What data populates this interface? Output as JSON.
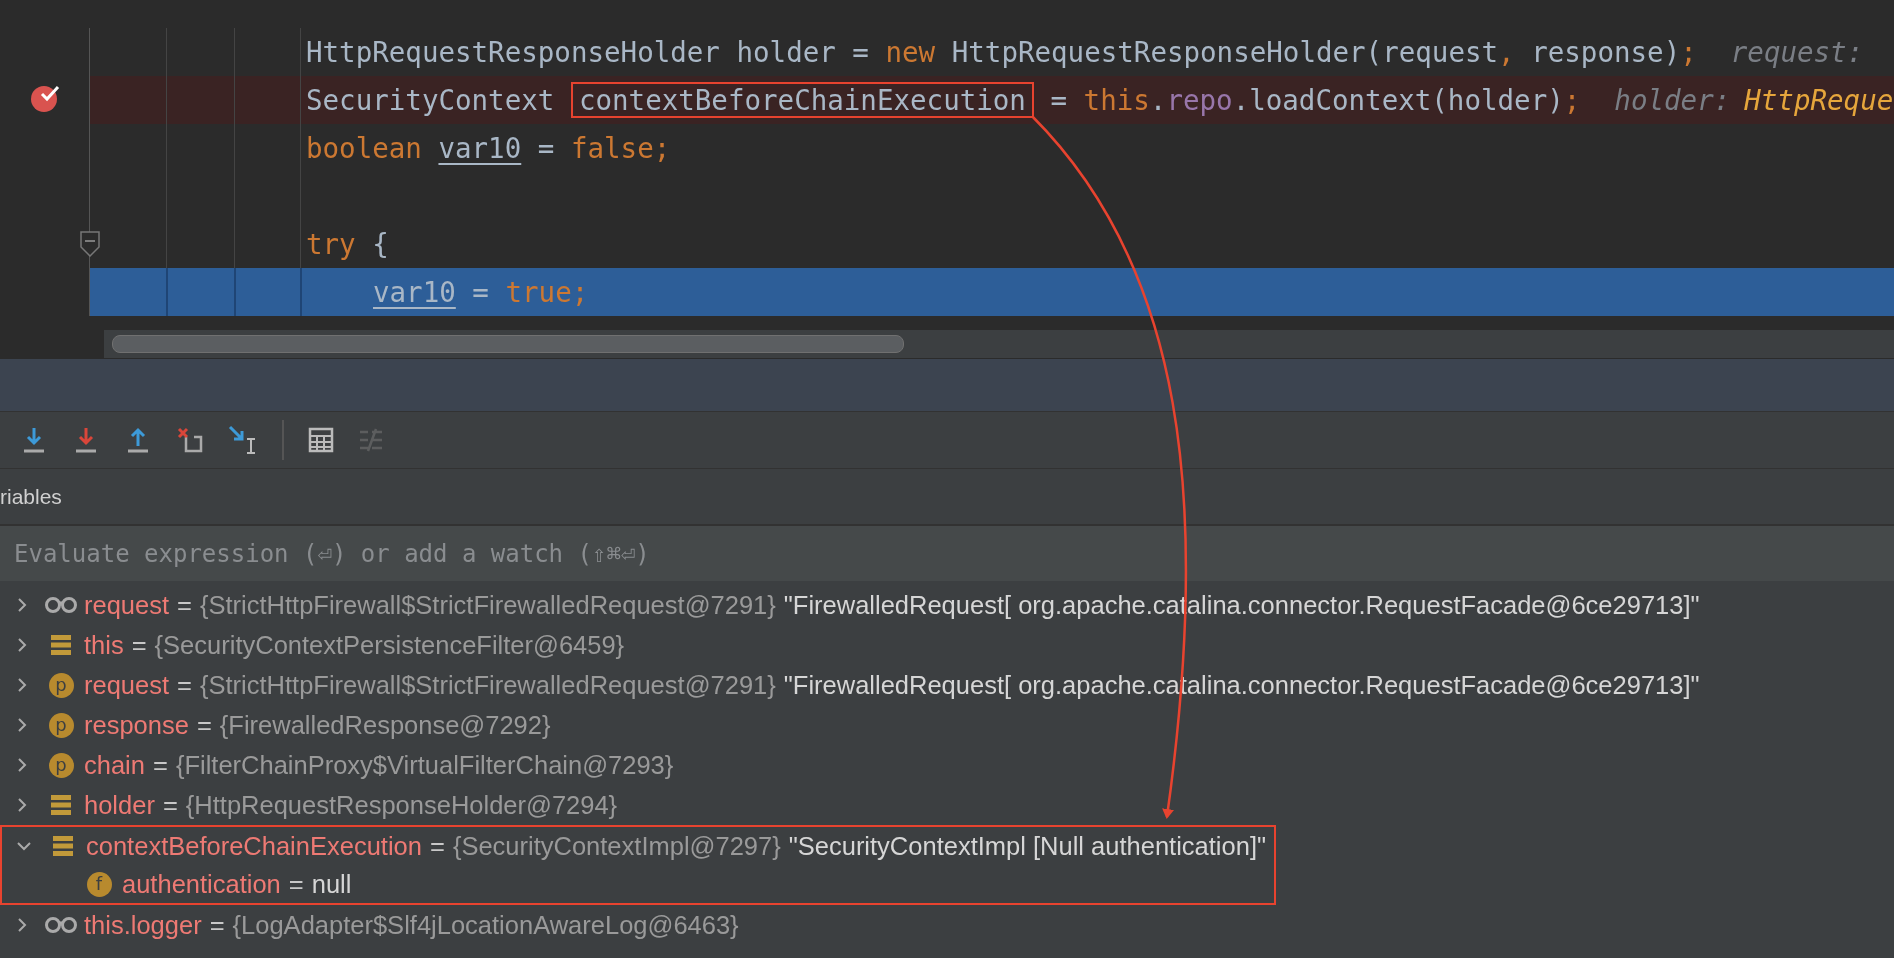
{
  "editor": {
    "lines": [
      {
        "breakpoint": false,
        "current": false,
        "fold": false,
        "indent": false,
        "tokens": [
          {
            "text": "HttpRequestResponseHolder holder = ",
            "kind": "plain"
          },
          {
            "text": "new",
            "kind": "keyword"
          },
          {
            "text": " HttpRequestResponseHolder(request",
            "kind": "plain"
          },
          {
            "text": ",",
            "kind": "keyword"
          },
          {
            "text": " response)",
            "kind": "plain"
          },
          {
            "text": ";",
            "kind": "keyword"
          },
          {
            "text": "request:",
            "kind": "hint"
          }
        ]
      },
      {
        "breakpoint": true,
        "current": false,
        "fold": false,
        "indent": false,
        "tokens": [
          {
            "text": "SecurityContext ",
            "kind": "plain"
          },
          {
            "text": "contextBeforeChainExecution",
            "kind": "plain",
            "boxed": true
          },
          {
            "text": " = ",
            "kind": "plain"
          },
          {
            "text": "this",
            "kind": "keyword"
          },
          {
            "text": ".",
            "kind": "plain"
          },
          {
            "text": "repo",
            "kind": "field"
          },
          {
            "text": ".loadContext(holder)",
            "kind": "plain"
          },
          {
            "text": ";",
            "kind": "keyword"
          },
          {
            "text": "holder:",
            "kind": "hint"
          },
          {
            "text": "HttpReque",
            "kind": "hint_value"
          }
        ]
      },
      {
        "breakpoint": false,
        "current": false,
        "fold": false,
        "indent": false,
        "tokens": [
          {
            "text": "boolean ",
            "kind": "keyword"
          },
          {
            "text": "var10",
            "kind": "var"
          },
          {
            "text": " = ",
            "kind": "plain"
          },
          {
            "text": "false;",
            "kind": "keyword"
          }
        ]
      },
      {
        "breakpoint": false,
        "current": false,
        "fold": false,
        "indent": false
      },
      {
        "breakpoint": false,
        "current": false,
        "fold": true,
        "indent": false,
        "tokens": [
          {
            "text": "try",
            "kind": "keyword"
          },
          {
            "text": " {",
            "kind": "plain"
          }
        ]
      },
      {
        "breakpoint": false,
        "current": true,
        "fold": false,
        "indent": true,
        "tokens": [
          {
            "text": "var10",
            "kind": "var"
          },
          {
            "text": " = ",
            "kind": "plain"
          },
          {
            "text": "true;",
            "kind": "keyword"
          }
        ]
      }
    ]
  },
  "toolbar": [
    {
      "kind": "step_over",
      "disabled": false
    },
    {
      "kind": "step_into",
      "disabled": false
    },
    {
      "kind": "step_out",
      "disabled": false
    },
    {
      "kind": "drop_frame",
      "disabled": false
    },
    {
      "kind": "run_to_cursor",
      "disabled": false
    },
    {
      "kind": "separator"
    },
    {
      "kind": "evaluate",
      "disabled": false
    },
    {
      "kind": "trace",
      "disabled": true
    }
  ],
  "variables_panel": {
    "title": "riables",
    "watch_field": {
      "placeholder": "Evaluate expression (⏎) or add a watch (⇧⌘⏎)"
    },
    "items": [
      {
        "kind": "watch",
        "name": "request",
        "operator": "=",
        "value": "{StrictHttpFirewall$StrictFirewalledRequest@7291}",
        "text": "\"FirewalledRequest[ org.apache.catalina.connector.RequestFacade@6ce29713]\"",
        "expanded": false,
        "boxed": false
      },
      {
        "kind": "local",
        "name": "this",
        "operator": "=",
        "value": "{SecurityContextPersistenceFilter@6459}",
        "expanded": false,
        "boxed": false
      },
      {
        "kind": "param",
        "badge": "p",
        "name": "request",
        "operator": "=",
        "value": "{StrictHttpFirewall$StrictFirewalledRequest@7291}",
        "text": "\"FirewalledRequest[ org.apache.catalina.connector.RequestFacade@6ce29713]\"",
        "expanded": false,
        "boxed": false
      },
      {
        "kind": "param",
        "badge": "p",
        "name": "response",
        "operator": "=",
        "value": "{FirewalledResponse@7292}",
        "expanded": false,
        "boxed": false
      },
      {
        "kind": "param",
        "badge": "p",
        "name": "chain",
        "operator": "=",
        "value": "{FilterChainProxy$VirtualFilterChain@7293}",
        "expanded": false,
        "boxed": false
      },
      {
        "kind": "local",
        "name": "holder",
        "operator": "=",
        "value": "{HttpRequestResponseHolder@7294}",
        "expanded": false,
        "boxed": false
      },
      {
        "kind": "local",
        "name": "contextBeforeChainExecution",
        "operator": "=",
        "value": "{SecurityContextImpl@7297}",
        "text": "\"SecurityContextImpl [Null authentication]\"",
        "expanded": true,
        "boxed": true,
        "children": [
          {
            "kind": "field",
            "badge": "f",
            "name": "authentication",
            "operator": "=",
            "text": "null"
          }
        ]
      },
      {
        "kind": "watch",
        "name": "this.logger",
        "operator": "=",
        "value": "{LogAdapter$Slf4jLocationAwareLog@6463}",
        "expanded": false,
        "boxed": false
      }
    ]
  }
}
